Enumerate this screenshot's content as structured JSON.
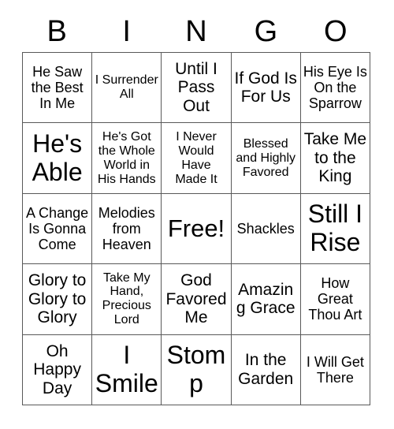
{
  "card": {
    "title": "Bingo Card",
    "header_letters": [
      "B",
      "I",
      "N",
      "G",
      "O"
    ],
    "free_space_label": "Free!",
    "grid_size": "5x5",
    "colors": {
      "grid_line": "#595959",
      "background": "#ffffff",
      "text": "#000000"
    },
    "rows": [
      [
        {
          "text": "He Saw the Best In Me",
          "size": "md"
        },
        {
          "text": "I Surrender All",
          "size": "sm"
        },
        {
          "text": "Until I Pass Out",
          "size": "lg"
        },
        {
          "text": "If God Is For Us",
          "size": "lg"
        },
        {
          "text": "His Eye Is On the Sparrow",
          "size": "md"
        }
      ],
      [
        {
          "text": "He's Able",
          "size": "xxl"
        },
        {
          "text": "He's Got the Whole World in His Hands",
          "size": "sm"
        },
        {
          "text": "I Never Would Have Made It",
          "size": "sm"
        },
        {
          "text": "Blessed and Highly Favored",
          "size": "sm"
        },
        {
          "text": "Take Me to the King",
          "size": "lg"
        }
      ],
      [
        {
          "text": "A Change Is Gonna Come",
          "size": "md"
        },
        {
          "text": "Melodies from Heaven",
          "size": "md"
        },
        {
          "text": "Free!",
          "size": "free"
        },
        {
          "text": "Shackles",
          "size": "md"
        },
        {
          "text": "Still I Rise",
          "size": "xxl"
        }
      ],
      [
        {
          "text": "Glory to Glory to Glory",
          "size": "lg"
        },
        {
          "text": "Take My Hand, Precious Lord",
          "size": "sm"
        },
        {
          "text": "God Favored Me",
          "size": "lg"
        },
        {
          "text": "Amazing Grace",
          "size": "lg"
        },
        {
          "text": "How Great Thou Art",
          "size": "md"
        }
      ],
      [
        {
          "text": "Oh Happy Day",
          "size": "lg"
        },
        {
          "text": "I Smile",
          "size": "xxl"
        },
        {
          "text": "Stomp",
          "size": "xxl"
        },
        {
          "text": "In the Garden",
          "size": "lg"
        },
        {
          "text": "I Will Get There",
          "size": "md"
        }
      ]
    ]
  }
}
